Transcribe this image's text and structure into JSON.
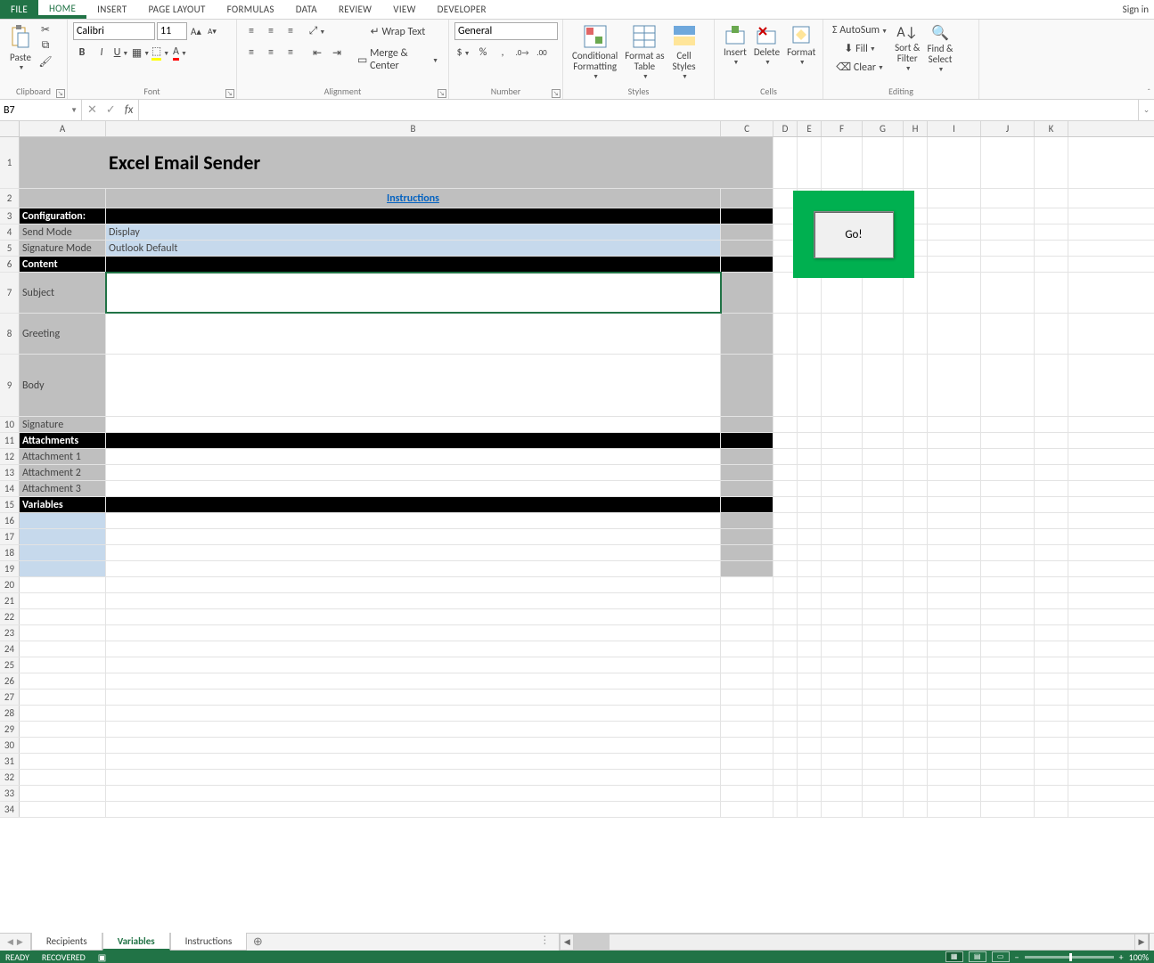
{
  "tabs": {
    "file": "FILE",
    "home": "HOME",
    "insert": "INSERT",
    "pagelayout": "PAGE LAYOUT",
    "formulas": "FORMULAS",
    "data": "DATA",
    "review": "REVIEW",
    "view": "VIEW",
    "developer": "DEVELOPER"
  },
  "signin": "Sign in",
  "ribbon": {
    "clipboard": {
      "paste": "Paste",
      "label": "Clipboard"
    },
    "font": {
      "name": "Calibri",
      "size": "11",
      "label": "Font"
    },
    "alignment": {
      "wrap": "Wrap Text",
      "merge": "Merge & Center",
      "label": "Alignment"
    },
    "number": {
      "format": "General",
      "label": "Number"
    },
    "styles": {
      "cond": "Conditional\nFormatting",
      "fat": "Format as\nTable",
      "cell": "Cell\nStyles",
      "label": "Styles"
    },
    "cells": {
      "insert": "Insert",
      "delete": "Delete",
      "format": "Format",
      "label": "Cells"
    },
    "editing": {
      "autosum": "AutoSum",
      "fill": "Fill",
      "clear": "Clear",
      "sort": "Sort &\nFilter",
      "find": "Find &\nSelect",
      "label": "Editing"
    }
  },
  "namebox": "B7",
  "formula": "",
  "columns": [
    "A",
    "B",
    "C",
    "D",
    "E",
    "F",
    "G",
    "H",
    "I",
    "J",
    "K"
  ],
  "sheet": {
    "title": "Excel Email Sender",
    "instructions": "Instructions",
    "sections": {
      "config_header": "Configuration:",
      "send_mode_label": "Send Mode",
      "send_mode_value": "Display",
      "sig_mode_label": "Signature Mode",
      "sig_mode_value": "Outlook Default",
      "content_header": "Content",
      "subject": "Subject",
      "greeting": "Greeting",
      "body": "Body",
      "signature": "Signature",
      "attachments_header": "Attachments",
      "att1": "Attachment 1",
      "att2": "Attachment 2",
      "att3": "Attachment 3",
      "variables_header": "Variables"
    },
    "go": "Go!"
  },
  "sheettabs": {
    "recipients": "Recipients",
    "variables": "Variables",
    "instructions": "Instructions"
  },
  "status": {
    "ready": "READY",
    "recovered": "RECOVERED",
    "zoom": "100%"
  }
}
